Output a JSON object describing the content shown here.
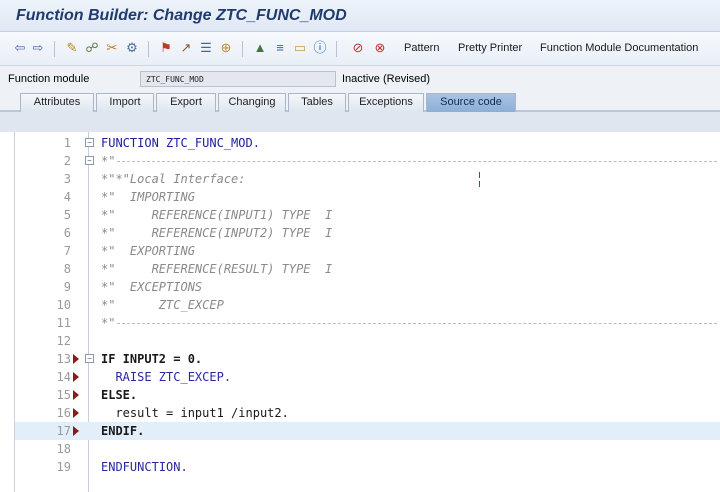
{
  "window": {
    "title": "Function Builder: Change ZTC_FUNC_MOD"
  },
  "toolbar": {
    "icons": [
      "back-arrow-icon",
      "forward-arrow-icon",
      "pencil-icon",
      "glasses-icon",
      "scissors-icon",
      "settings-icon",
      "activate-icon",
      "test-icon",
      "object-list-icon",
      "hierarchy-icon",
      "display-icon",
      "info-icon",
      "breakpoint-icon",
      "session-breakpoint-icon"
    ],
    "pattern_label": "Pattern",
    "pretty_printer_label": "Pretty Printer",
    "fm_doc_label": "Function Module Documentation"
  },
  "function_module": {
    "label": "Function module",
    "value": "ZTC_FUNC_MOD",
    "status": "Inactive (Revised)"
  },
  "tabs": [
    {
      "label": "Attributes"
    },
    {
      "label": "Import"
    },
    {
      "label": "Export"
    },
    {
      "label": "Changing"
    },
    {
      "label": "Tables"
    },
    {
      "label": "Exceptions"
    },
    {
      "label": "Source code",
      "active": true
    }
  ],
  "code_lines": [
    {
      "num": "1",
      "text": "FUNCTION ZTC_FUNC_MOD."
    },
    {
      "num": "2",
      "text": "*\""
    },
    {
      "num": "3",
      "text": "*\"*\"Local Interface:"
    },
    {
      "num": "4",
      "text": "*\"  IMPORTING"
    },
    {
      "num": "5",
      "text": "*\"     REFERENCE(INPUT1) TYPE  I"
    },
    {
      "num": "6",
      "text": "*\"     REFERENCE(INPUT2) TYPE  I"
    },
    {
      "num": "7",
      "text": "*\"  EXPORTING"
    },
    {
      "num": "8",
      "text": "*\"     REFERENCE(RESULT) TYPE  I"
    },
    {
      "num": "9",
      "text": "*\"  EXCEPTIONS"
    },
    {
      "num": "10",
      "text": "*\"      ZTC_EXCEP"
    },
    {
      "num": "11",
      "text": "*\""
    },
    {
      "num": "12",
      "text": ""
    },
    {
      "num": "13",
      "text": "IF INPUT2 = 0."
    },
    {
      "num": "14",
      "text": "  RAISE ZTC_EXCEP."
    },
    {
      "num": "15",
      "text": "ELSE."
    },
    {
      "num": "16",
      "text": "  result = input1 /input2."
    },
    {
      "num": "17",
      "text": "ENDIF."
    },
    {
      "num": "18",
      "text": ""
    },
    {
      "num": "19",
      "text": "ENDFUNCTION."
    }
  ]
}
